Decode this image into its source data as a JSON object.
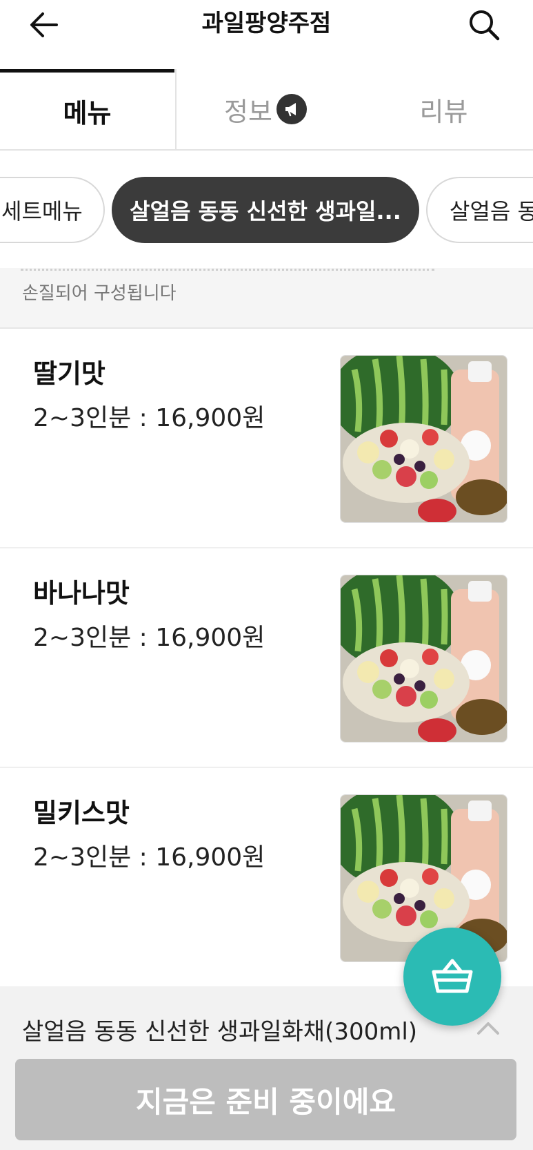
{
  "header": {
    "title": "과일팡양주점",
    "back_icon": "arrow-left-icon",
    "search_icon": "search-icon"
  },
  "tabs": [
    {
      "label": "메뉴",
      "active": true
    },
    {
      "label": "정보",
      "active": false,
      "badge_icon": "megaphone-icon"
    },
    {
      "label": "리뷰",
      "active": false
    }
  ],
  "chips": [
    {
      "label": "세트메뉴",
      "active": false
    },
    {
      "label": "살얼음 동동 신선한 생과일...",
      "active": true
    },
    {
      "label": "살얼음 동",
      "active": false
    }
  ],
  "category_description": "손질되어 구성됩니다",
  "menu_items": [
    {
      "name": "딸기맛",
      "price": "2~3인분 : 16,900원"
    },
    {
      "name": "바나나맛",
      "price": "2~3인분 : 16,900원"
    },
    {
      "name": "밀키스맛",
      "price": "2~3인분 : 16,900원"
    }
  ],
  "bottom_bar": {
    "category_label": "살얼음 동동 신선한 생과일화채(300ml)",
    "status_button": "지금은 준비 중이에요"
  },
  "fab": {
    "icon": "basket-icon"
  },
  "colors": {
    "accent": "#2bbbb4",
    "chip_active": "#3b3b3b",
    "disabled_button": "#bdbdbd"
  }
}
